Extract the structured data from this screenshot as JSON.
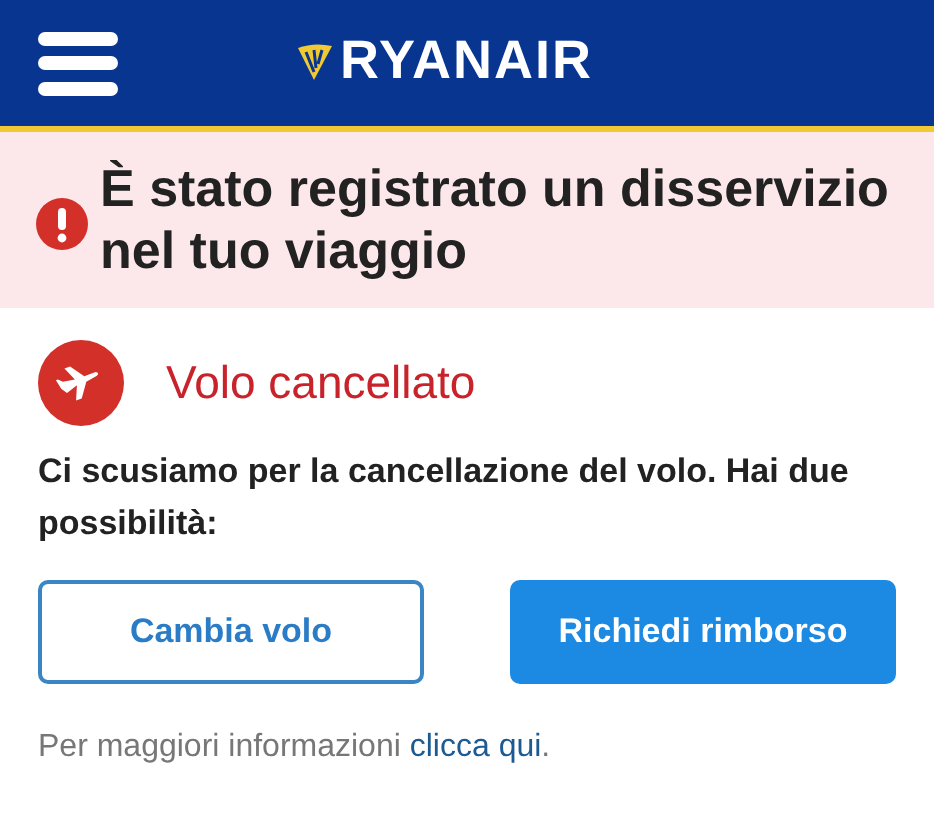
{
  "header": {
    "logo_text": "RYANAIR"
  },
  "alert": {
    "title": "È stato registrato un disservizio nel tuo viaggio"
  },
  "notice": {
    "title": "Volo cancellato",
    "message": "Ci scusiamo per la cancellazione del volo. Hai due possibilità:"
  },
  "buttons": [
    {
      "label": "Cambia volo",
      "kind": "outline"
    },
    {
      "label": "Richiedi rimborso",
      "kind": "filled"
    }
  ],
  "more_info": {
    "text": "Per maggiori informazioni ",
    "link": "clicca qui",
    "suffix": "."
  }
}
